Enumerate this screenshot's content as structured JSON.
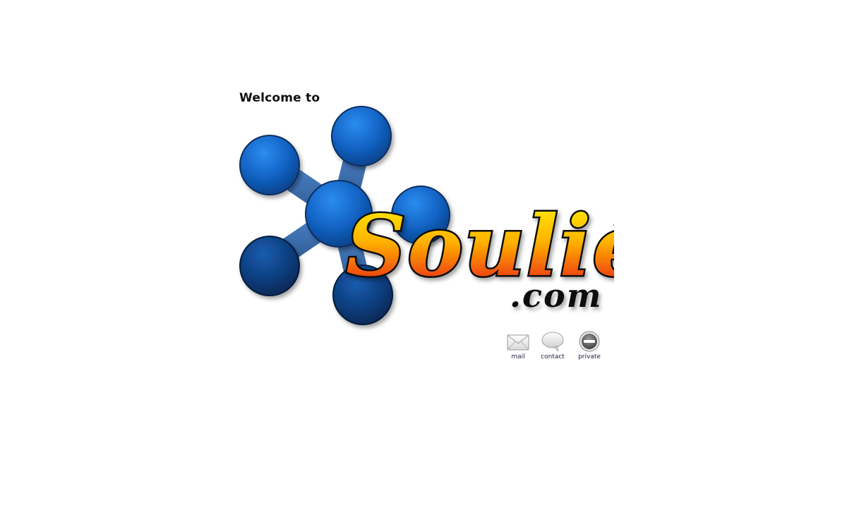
{
  "page": {
    "welcome_text": "Welcome to",
    "logo": {
      "wordmark": "Soulié",
      "domain_suffix": ".com",
      "colors": {
        "node_blue_light": "#1a6fd6",
        "node_blue_dark": "#0a2f5e",
        "text_yellow": "#ffee00",
        "text_red": "#e81f10",
        "outline": "#111111"
      }
    },
    "links": [
      {
        "label": "mail",
        "icon": "envelope-icon"
      },
      {
        "label": "contact",
        "icon": "speech-bubble-icon"
      },
      {
        "label": "private",
        "icon": "no-entry-icon"
      }
    ]
  }
}
